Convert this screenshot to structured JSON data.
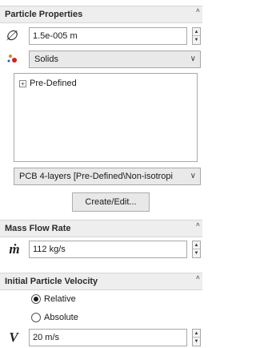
{
  "particle_properties": {
    "header": "Particle Properties",
    "diameter_value": "1.5e-005 m",
    "material_type": "Solids",
    "tree_item": "Pre-Defined",
    "material_selected": "PCB 4-layers [Pre-Defined\\Non-isotropi",
    "create_edit_label": "Create/Edit..."
  },
  "mass_flow": {
    "header": "Mass Flow Rate",
    "value": "112 kg/s"
  },
  "initial_velocity": {
    "header": "Initial Particle Velocity",
    "option_relative": "Relative",
    "option_absolute": "Absolute",
    "selected": "Relative",
    "value": "20 m/s",
    "symbol": "V"
  },
  "icons": {
    "diameter": "diameter-icon",
    "material": "particles-icon",
    "mass_flow": "mass-flow-icon",
    "velocity": "velocity-icon"
  },
  "colors": {
    "header_bg": "#eeeeee",
    "combo_bg": "#e9e9e9",
    "particle_red": "#d62020",
    "particle_blue": "#2a5fb8"
  }
}
